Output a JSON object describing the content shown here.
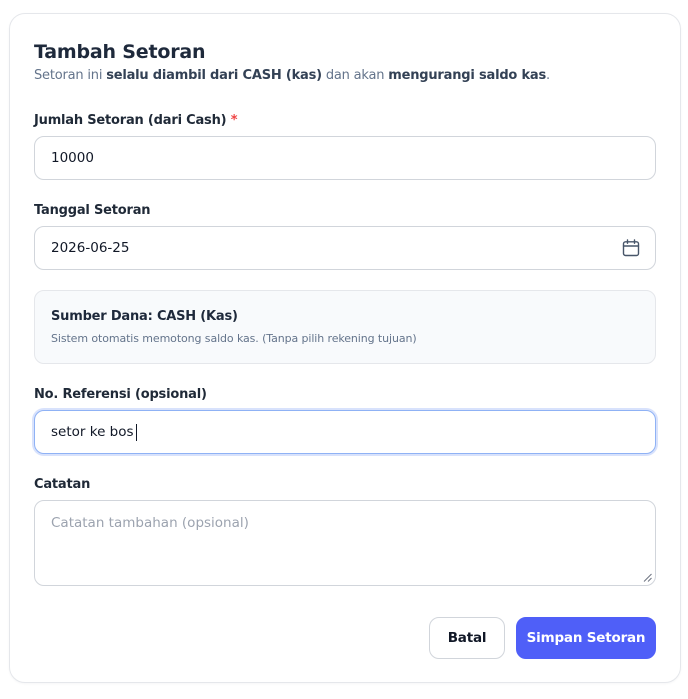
{
  "form": {
    "title": "Tambah Setoran",
    "subtitle": {
      "part1": "Setoran ini ",
      "bold1": "selalu diambil dari CASH (kas)",
      "part2": " dan akan ",
      "bold2": "mengurangi saldo kas",
      "part3": "."
    },
    "amount": {
      "label": "Jumlah Setoran (dari Cash)",
      "required_mark": "*",
      "value": "10000"
    },
    "date": {
      "label": "Tanggal Setoran",
      "value": "2026-06-25",
      "icon": "calendar-icon"
    },
    "source_info": {
      "title": "Sumber Dana: CASH (Kas)",
      "description": "Sistem otomatis memotong saldo kas. (Tanpa pilih rekening tujuan)"
    },
    "reference": {
      "label": "No. Referensi (opsional)",
      "value": "setor ke bos"
    },
    "notes": {
      "label": "Catatan",
      "placeholder": "Catatan tambahan (opsional)"
    },
    "actions": {
      "cancel_label": "Batal",
      "save_label": "Simpan Setoran"
    }
  },
  "colors": {
    "primary": "#4f5ff8",
    "required": "#ef4444",
    "focus_border": "#8fb2f5"
  }
}
